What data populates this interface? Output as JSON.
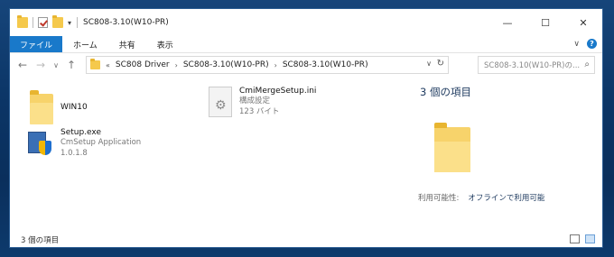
{
  "window": {
    "title": "SC808-3.10(W10-PR)",
    "controls": {
      "minimize": "—",
      "maximize": "☐",
      "close": "✕"
    }
  },
  "ribbon": {
    "tabs": [
      "ファイル",
      "ホーム",
      "共有",
      "表示"
    ],
    "expand_glyph": "∨",
    "help_glyph": "?"
  },
  "address": {
    "back": "←",
    "forward": "→",
    "recent": "∨",
    "up": "↑",
    "overflow": "«",
    "breadcrumbs": [
      "SC808 Driver",
      "SC808-3.10(W10-PR)",
      "SC808-3.10(W10-PR)"
    ],
    "crumb_sep": "›",
    "dropdown": "∨",
    "refresh": "↻"
  },
  "search": {
    "placeholder": "SC808-3.10(W10-PR)の..."
  },
  "items": [
    {
      "name": "WIN10",
      "icon": "folder-icon",
      "subtitle": "",
      "detail": ""
    },
    {
      "name": "CmiMergeSetup.ini",
      "icon": "ini-file-icon",
      "subtitle": "構成設定",
      "detail": "123 バイト"
    },
    {
      "name": "Setup.exe",
      "icon": "setup-exe-icon",
      "subtitle": "CmSetup Application",
      "detail": "1.0.1.8"
    }
  ],
  "details_pane": {
    "title": "3 個の項目",
    "availability_label": "利用可能性:",
    "availability_value": "オフラインで利用可能"
  },
  "status": {
    "count": "3 個の項目"
  }
}
